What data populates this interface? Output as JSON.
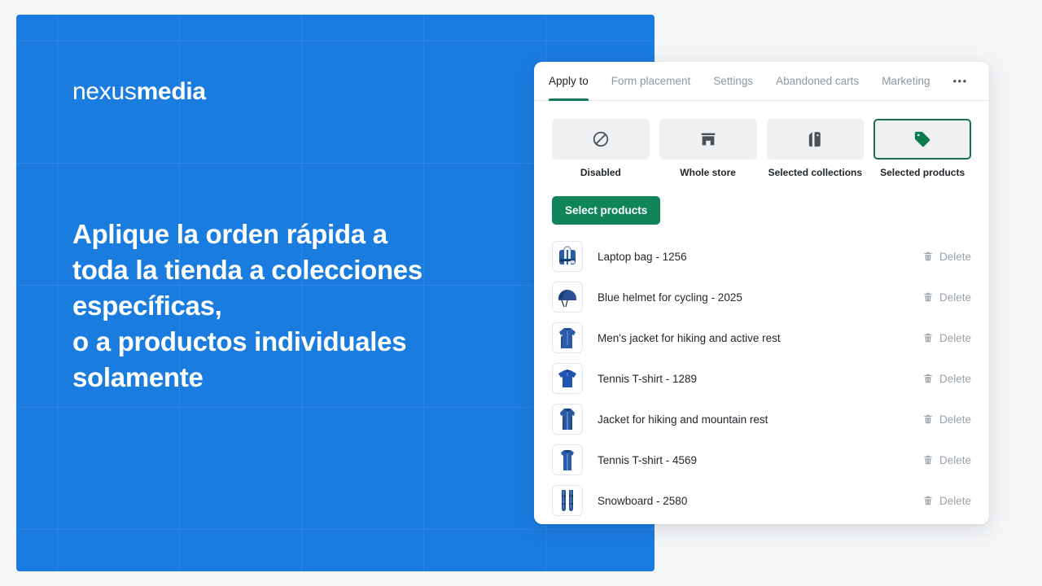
{
  "theme": {
    "promo_blue": "#1b7ce0",
    "page_background": "#f4f6f8",
    "accent_green": "#10855a",
    "selected_border_green": "#1a6e4c",
    "active_tab_underline": "#107a53",
    "text_dark": "#22272b",
    "text_muted": "#8f979f",
    "delete_gray": "#9aa2aa"
  },
  "promo": {
    "logo": {
      "light_part": "nexus",
      "bold_part": "media"
    },
    "headline": "Aplique la orden rápida a\ntoda la tienda a colecciones específicas,\no a productos individuales solamente"
  },
  "app": {
    "tabs": [
      {
        "label": "Apply to",
        "active": true
      },
      {
        "label": "Form placement",
        "active": false
      },
      {
        "label": "Settings",
        "active": false
      },
      {
        "label": "Abandoned carts",
        "active": false
      },
      {
        "label": "Marketing",
        "active": false
      }
    ],
    "overflow_menu": {
      "label": "•••",
      "icon": "ellipsis-icon"
    },
    "apply_to_options": [
      {
        "label": "Disabled",
        "icon": "slash-circle-icon",
        "selected": false
      },
      {
        "label": "Whole store",
        "icon": "store-icon",
        "selected": false
      },
      {
        "label": "Selected collections",
        "icon": "collection-tags-icon",
        "selected": false
      },
      {
        "label": "Selected products",
        "icon": "price-tag-icon",
        "selected": true
      }
    ],
    "select_products_button": "Select products",
    "delete_label": "Delete",
    "delete_icon": "trash-icon",
    "products": [
      {
        "title": "Laptop bag - 1256",
        "thumb": "laptop-bag-thumb"
      },
      {
        "title": "Blue helmet for cycling - 2025",
        "thumb": "blue-helmet-thumb"
      },
      {
        "title": "Men's jacket for hiking and active rest",
        "thumb": "mens-jacket-thumb"
      },
      {
        "title": "Tennis T-shirt - 1289",
        "thumb": "tennis-tshirt-polo-thumb"
      },
      {
        "title": "Jacket for hiking and mountain rest",
        "thumb": "hiking-jacket-thumb"
      },
      {
        "title": "Tennis T-shirt - 4569",
        "thumb": "tennis-tank-thumb"
      },
      {
        "title": "Snowboard - 2580",
        "thumb": "snowboard-skis-thumb"
      }
    ]
  }
}
